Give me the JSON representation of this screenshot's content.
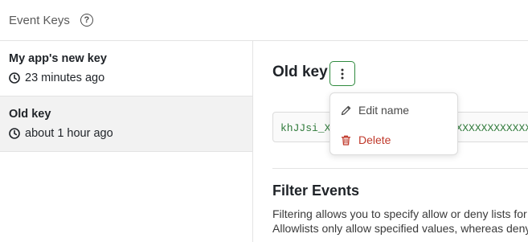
{
  "header": {
    "title": "Event Keys",
    "help_icon": "question-circle-icon",
    "help_glyph": "?"
  },
  "sidebar": {
    "items": [
      {
        "name": "My app's new key",
        "time": "23 minutes ago",
        "icon": "clock-icon",
        "active": false
      },
      {
        "name": "Old key",
        "time": "about 1 hour ago",
        "icon": "clock-icon",
        "active": true
      }
    ]
  },
  "main": {
    "title": "Old key",
    "more_icon": "vertical-dots-icon",
    "key_value": "khJJsi_XXXXXXXXXXXXXXXXXXXXXXXXXXXXXXXXX...",
    "filter": {
      "title": "Filter Events",
      "line1": "Filtering allows you to specify allow or deny lists for",
      "line2": "Allowlists only allow specified values, whereas deny"
    }
  },
  "menu": {
    "items": [
      {
        "label": "Edit name",
        "icon": "pencil-icon"
      },
      {
        "label": "Delete",
        "icon": "trash-icon"
      }
    ]
  },
  "colors": {
    "accent": "#2f8a3e",
    "danger": "#c0392b",
    "key_text": "#2f7a3a"
  }
}
